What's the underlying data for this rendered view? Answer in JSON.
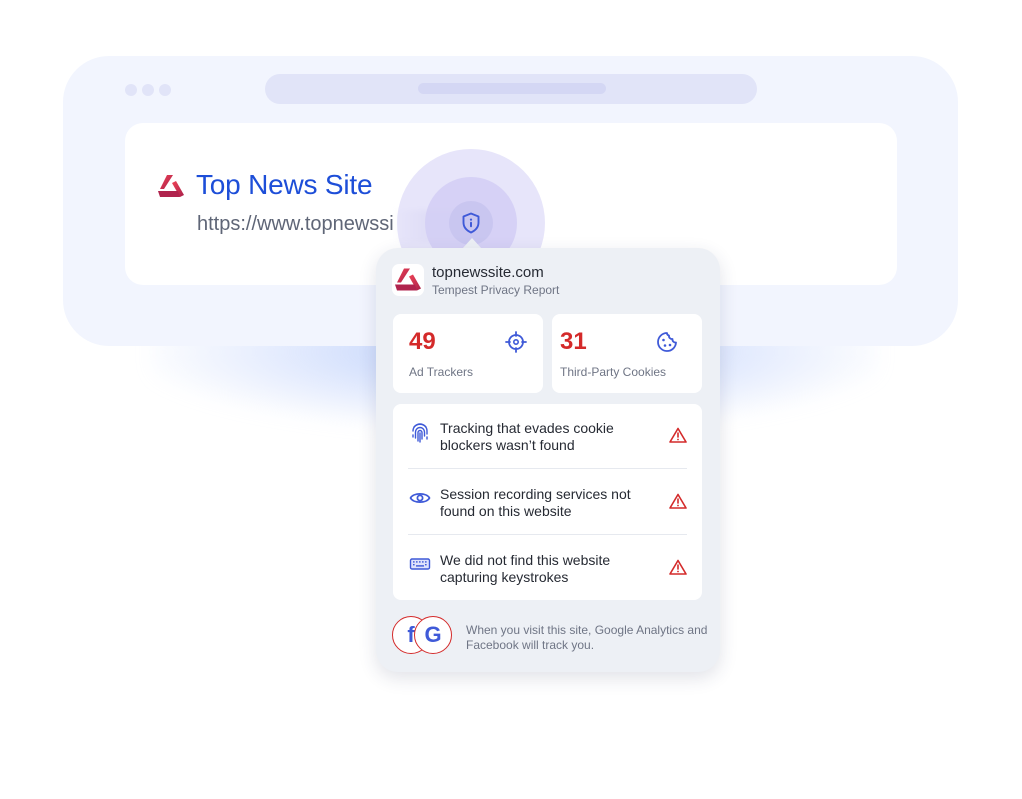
{
  "browser": {
    "window_dots": 3,
    "site": {
      "title": "Top News Site",
      "url": "https://www.topnewssi"
    },
    "shield_button": {
      "icon": "shield-info-icon"
    }
  },
  "popup": {
    "domain": "topnewssite.com",
    "subtitle": "Tempest Privacy Report",
    "stats": [
      {
        "value": "49",
        "label": "Ad Trackers",
        "icon": "crosshair-icon"
      },
      {
        "value": "31",
        "label": "Third-Party Cookies",
        "icon": "cookie-icon"
      }
    ],
    "checks": [
      {
        "text": "Tracking that evades cookie blockers wasn’t found",
        "icon": "fingerprint-icon",
        "status_icon": "warning-icon"
      },
      {
        "text": "Session recording services not found on this website",
        "icon": "eye-icon",
        "status_icon": "warning-icon"
      },
      {
        "text": "We did not find this website capturing keystrokes",
        "icon": "keyboard-icon",
        "status_icon": "warning-icon"
      }
    ],
    "footer": {
      "brands": [
        {
          "glyph": "f",
          "name": "Facebook"
        },
        {
          "glyph": "G",
          "name": "Google Analytics"
        }
      ],
      "text": "When you visit this site, Google Analytics and Facebook will track you."
    }
  },
  "colors": {
    "brand_blue": "#1d4ed8",
    "stat_red": "#d42a2a",
    "icon_blue": "#3f5ad8",
    "warning_red": "#d42a2a",
    "popup_bg": "#edf0f5",
    "browser_bg": "#f2f5fe"
  }
}
